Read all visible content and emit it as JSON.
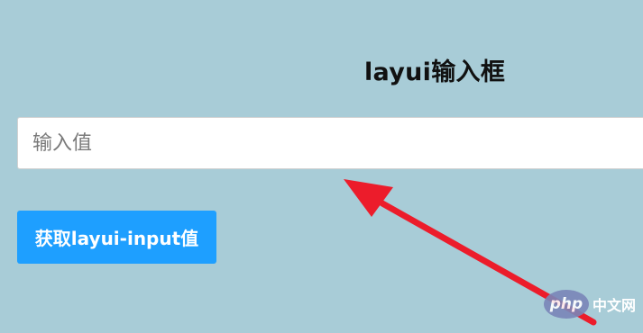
{
  "page": {
    "title": "layui输入框"
  },
  "form": {
    "input_placeholder": "输入值",
    "input_value": "",
    "button_label": "获取layui-input值"
  },
  "colors": {
    "background": "#a8ccd7",
    "button": "#1e9fff",
    "arrow": "#ec1c2b"
  },
  "watermark": {
    "logo_text": "php",
    "site_text": "中文网"
  },
  "annotations": {
    "arrow_icon": "red-arrow-icon"
  }
}
